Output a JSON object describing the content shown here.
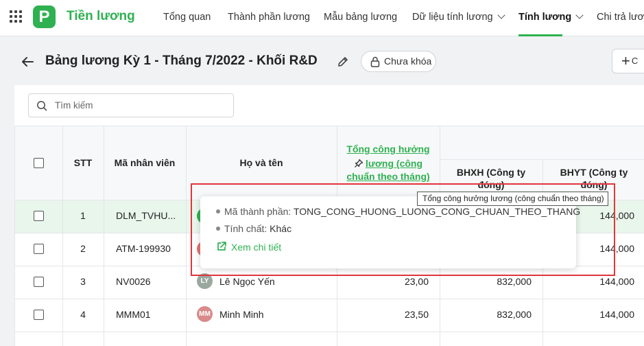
{
  "app": {
    "name": "Tiền lương",
    "logo_letter": "P",
    "brand_color": "#2fb151"
  },
  "nav": [
    {
      "label": "Tổng quan"
    },
    {
      "label": "Thành phần lương"
    },
    {
      "label": "Mẫu bảng lương"
    },
    {
      "label": "Dữ liệu tính lương"
    },
    {
      "label": "Tính lương"
    },
    {
      "label": "Chi trả lươn"
    }
  ],
  "page": {
    "title": "Bảng lương Kỳ 1 - Tháng 7/2022 - Khối R&D",
    "lock_status": "Chưa khóa",
    "add_label": "C"
  },
  "search": {
    "placeholder": "Tìm kiếm"
  },
  "table": {
    "headers": {
      "stt": "STT",
      "employee_code": "Mã nhân viên",
      "full_name": "Họ và tên",
      "total_line1": "Tổng công hưởng",
      "total_line2": "lương (công",
      "total_line3": "chuẩn theo tháng)",
      "bhxh_line1": "BHXH (Công ty",
      "bhxh_line2": "đóng)",
      "bhyt_line1": "BHYT (Công ty",
      "bhyt_line2": "đóng)"
    },
    "rows": [
      {
        "stt": "1",
        "code": "DLM_TVHU...",
        "name": "",
        "initials": "",
        "avatar_color": "#2fb151",
        "total": "",
        "bhxh": "",
        "bhyt": "144,000"
      },
      {
        "stt": "2",
        "code": "ATM-199930",
        "name": "",
        "initials": "",
        "avatar_color": "#e57373",
        "total": "",
        "bhxh": "",
        "bhyt": "144,000"
      },
      {
        "stt": "3",
        "code": "NV0026",
        "name": "Lê Ngọc Yến",
        "initials": "LY",
        "avatar_color": "#9aa8a0",
        "total": "23,00",
        "bhxh": "832,000",
        "bhyt": "144,000"
      },
      {
        "stt": "4",
        "code": "MMM01",
        "name": "Minh Minh",
        "initials": "MM",
        "avatar_color": "#d88a8a",
        "total": "23,50",
        "bhxh": "832,000",
        "bhyt": "144,000"
      }
    ]
  },
  "popover": {
    "code_label": "Mã thành phần:",
    "code_value": "TONG_CONG_HUONG_LUONG_CONG_CHUAN_THEO_THANG",
    "nature_label": "Tính chất:",
    "nature_value": "Khác",
    "detail_link": "Xem chi tiết"
  },
  "tooltip": {
    "text": "Tổng công hưởng lương (công chuẩn theo tháng)"
  }
}
